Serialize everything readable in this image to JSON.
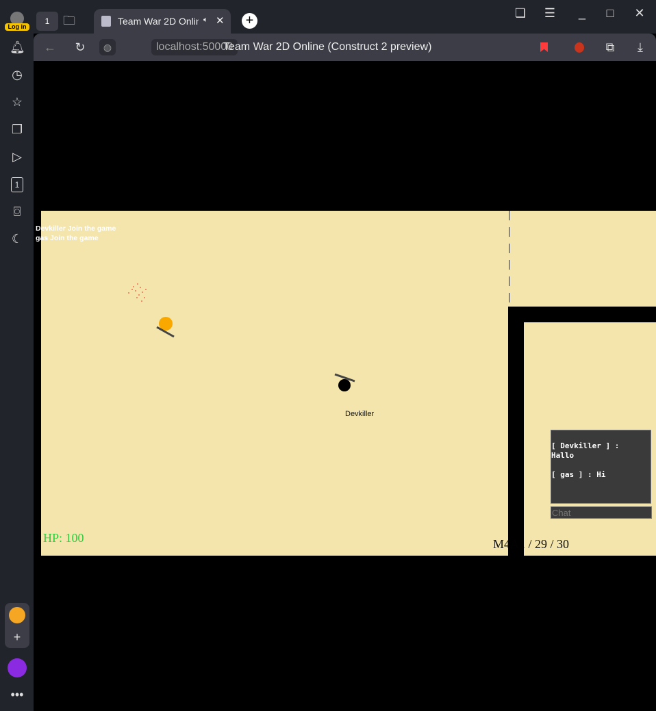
{
  "browser": {
    "login_label": "Log in",
    "tab_count": "1",
    "tab_title": "Team War 2D Online",
    "url": "localhost:50000",
    "page_title": "Team War 2D Online (Construct 2 preview)",
    "sidebar_count": "1"
  },
  "game": {
    "messages": [
      "Devkiller Join the game",
      "gas Join the game"
    ],
    "player_name": "Devkiller",
    "hp": "HP: 100",
    "ammo": "M4A1 / 29 / 30",
    "chat": {
      "lines": "[ Devkiller ] :\nHallo\n\n[ gas ] : Hi",
      "placeholder": "Chat"
    },
    "colors": {
      "sand": "#f3e5ab",
      "hp": "#2ecc40",
      "enemy": "#f9a800"
    }
  }
}
